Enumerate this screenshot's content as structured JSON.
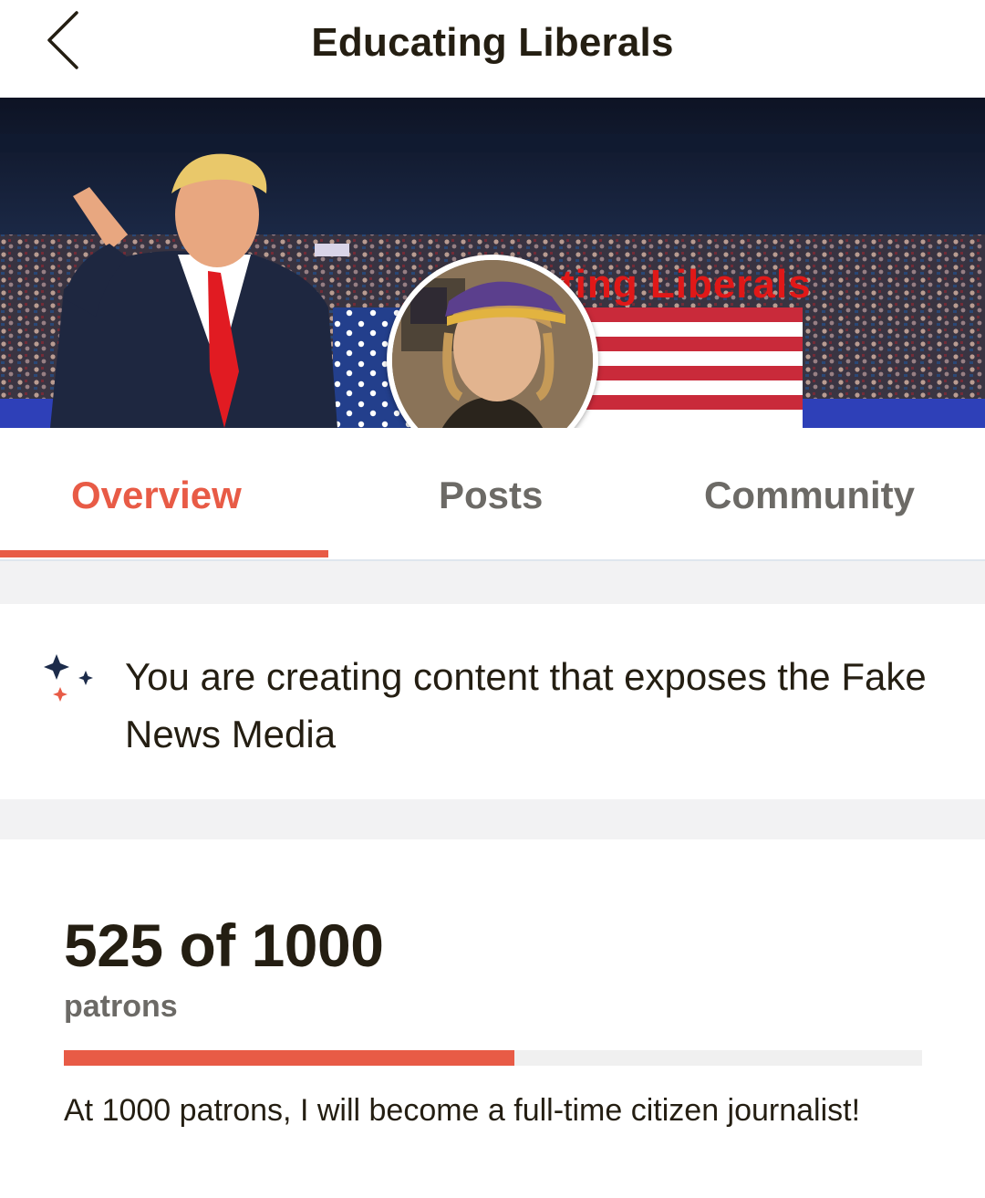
{
  "header": {
    "title": "Educating Liberals",
    "back_icon": "chevron-left-icon"
  },
  "banner": {
    "text": "ting Liberals",
    "text_color": "#e01818"
  },
  "tabs": [
    {
      "label": "Overview",
      "active": true
    },
    {
      "label": "Posts",
      "active": false
    },
    {
      "label": "Community",
      "active": false
    }
  ],
  "about": {
    "icon": "sparkle-icon",
    "text": "You are creating content that exposes the Fake News Media"
  },
  "goal": {
    "current": 525,
    "target": 1000,
    "count_text": "525 of 1000",
    "unit": "patrons",
    "progress_fraction": 0.525,
    "description": "At 1000 patrons, I will become a full-time citizen journalist!"
  },
  "colors": {
    "accent": "#e85b46",
    "text": "#241e12",
    "muted": "#6c6a66",
    "band": "#f2f2f3"
  }
}
